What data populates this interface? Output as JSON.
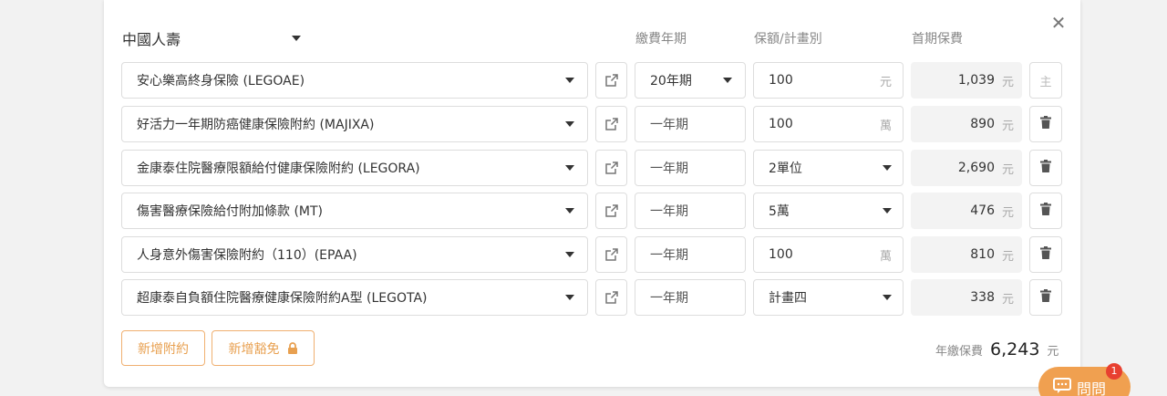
{
  "company": "中國人壽",
  "headers": {
    "term": "繳費年期",
    "amount": "保額/計畫別",
    "premium": "首期保費"
  },
  "currency": "元",
  "main_marker": "主",
  "rows": [
    {
      "plan": "安心樂高終身保險 (LEGOAE)",
      "term": "20年期",
      "term_dropdown": true,
      "amount": "100",
      "amount_unit": "元",
      "amount_dropdown": false,
      "premium": "1,039",
      "is_main": true
    },
    {
      "plan": "好活力一年期防癌健康保險附約 (MAJIXA)",
      "term": "一年期",
      "term_dropdown": false,
      "amount": "100",
      "amount_unit": "萬",
      "amount_dropdown": false,
      "premium": "890",
      "is_main": false
    },
    {
      "plan": "金康泰住院醫療限額給付健康保險附約 (LEGORA)",
      "term": "一年期",
      "term_dropdown": false,
      "amount": "2單位",
      "amount_unit": "",
      "amount_dropdown": true,
      "premium": "2,690",
      "is_main": false
    },
    {
      "plan": "傷害醫療保險給付附加條款 (MT)",
      "term": "一年期",
      "term_dropdown": false,
      "amount": "5萬",
      "amount_unit": "",
      "amount_dropdown": true,
      "premium": "476",
      "is_main": false
    },
    {
      "plan": "人身意外傷害保險附約（110）(EPAA)",
      "term": "一年期",
      "term_dropdown": false,
      "amount": "100",
      "amount_unit": "萬",
      "amount_dropdown": false,
      "premium": "810",
      "is_main": false
    },
    {
      "plan": "超康泰自負額住院醫療健康保險附約A型 (LEGOTA)",
      "term": "一年期",
      "term_dropdown": false,
      "amount": "計畫四",
      "amount_unit": "",
      "amount_dropdown": true,
      "premium": "338",
      "is_main": false
    }
  ],
  "buttons": {
    "add_rider": "新增附約",
    "add_waiver": "新增豁免"
  },
  "total": {
    "label": "年繳保費",
    "value": "6,243",
    "unit": "元"
  },
  "chat": {
    "label": "問問",
    "badge": "1"
  },
  "icons": {
    "close": "close-icon",
    "external": "external-link-icon",
    "trash": "trash-icon",
    "lock": "lock-icon",
    "chat": "chat-icon"
  }
}
